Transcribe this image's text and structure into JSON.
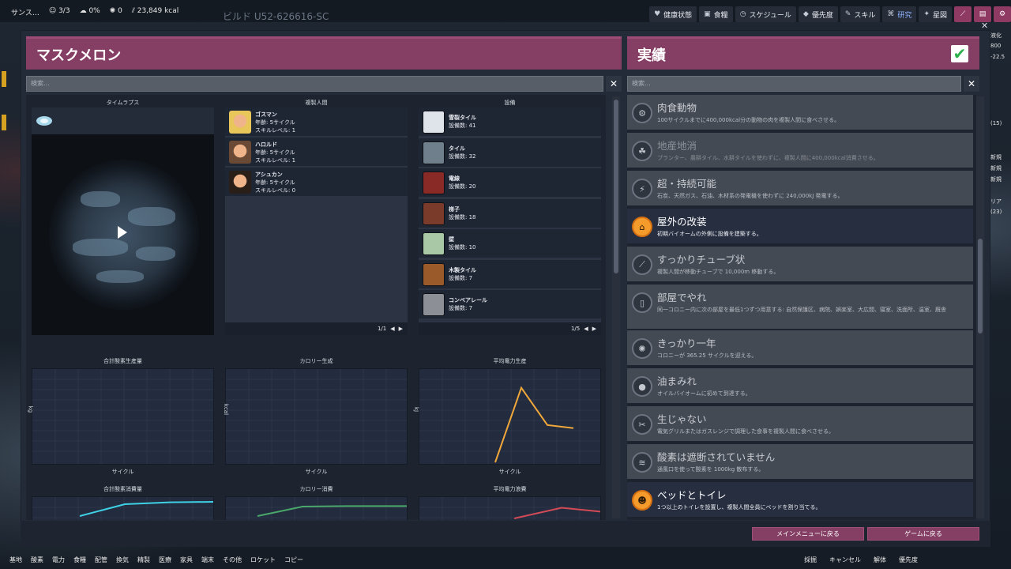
{
  "hud": {
    "colony_label": "サンス…",
    "dupes": "3/3",
    "stress": "0%",
    "germs": "0",
    "calories": "23,849 kcal",
    "build_title": "ビルド U52-626616-SC"
  },
  "topnav": [
    {
      "icon": "heart-icon",
      "glyph": "♥",
      "label": "健康状態"
    },
    {
      "icon": "food-icon",
      "glyph": "▣",
      "label": "食糧"
    },
    {
      "icon": "schedule-icon",
      "glyph": "◷",
      "label": "スケジュール"
    },
    {
      "icon": "priority-icon",
      "glyph": "◆",
      "label": "優先度"
    },
    {
      "icon": "skills-icon",
      "glyph": "✎",
      "label": "スキル"
    },
    {
      "icon": "research-icon",
      "glyph": "⌘",
      "label": "研究"
    },
    {
      "icon": "starmap-icon",
      "glyph": "✦",
      "label": "星図"
    }
  ],
  "left_panel": {
    "title": "マスクメロン",
    "search_placeholder": "検索...",
    "timelapse_label": "タイムラプス",
    "dupes_label": "複製人間",
    "buildings_label": "設備",
    "duplicants": [
      {
        "name": "ゴスマン",
        "age": "年齢: 5サイクル",
        "skill": "スキルレベル: 1",
        "color": "#e8c65a"
      },
      {
        "name": "ハロルド",
        "age": "年齢: 5サイクル",
        "skill": "スキルレベル: 1",
        "color": "#6a4a34"
      },
      {
        "name": "アシュカン",
        "age": "年齢: 5サイクル",
        "skill": "スキルレベル: 0",
        "color": "#2a1e18"
      }
    ],
    "dupes_pager": "1/1",
    "buildings": [
      {
        "name": "雪裂タイル",
        "count": "設備数: 41",
        "color": "#dfe4ea"
      },
      {
        "name": "タイル",
        "count": "設備数: 32",
        "color": "#6f7f8c"
      },
      {
        "name": "電線",
        "count": "設備数: 20",
        "color": "#8a2a26"
      },
      {
        "name": "梯子",
        "count": "設備数: 18",
        "color": "#7a3b2a"
      },
      {
        "name": "壁",
        "count": "設備数: 10",
        "color": "#a9c8a6"
      },
      {
        "name": "木製タイル",
        "count": "設備数: 7",
        "color": "#9a5a2a"
      },
      {
        "name": "コンベアレール",
        "count": "設備数: 7",
        "color": "#8c9096"
      }
    ],
    "buildings_pager": "1/5",
    "charts": [
      {
        "title": "合計酸素生産量",
        "ylabel": "kg",
        "xlabel": "サイクル"
      },
      {
        "title": "カロリー生成",
        "ylabel": "kcal",
        "xlabel": "サイクル"
      },
      {
        "title": "平均電力生産",
        "ylabel": "kJ",
        "xlabel": "サイクル"
      },
      {
        "title": "合計酸素消費量",
        "ylabel": "",
        "xlabel": ""
      },
      {
        "title": "カロリー消費",
        "ylabel": "",
        "xlabel": ""
      },
      {
        "title": "平均電力浪費",
        "ylabel": "",
        "xlabel": ""
      }
    ]
  },
  "chart_data": [
    {
      "type": "line",
      "title": "合計酸素生産量",
      "ylabel": "kg",
      "xlabel": "サイクル",
      "series": []
    },
    {
      "type": "line",
      "title": "カロリー生成",
      "ylabel": "kcal",
      "xlabel": "サイクル",
      "series": []
    },
    {
      "type": "line",
      "title": "平均電力生産",
      "ylabel": "kJ",
      "xlabel": "サイクル",
      "x": [
        2,
        3,
        4,
        5
      ],
      "series": [
        {
          "values": [
            0,
            24,
            12,
            11
          ],
          "color": "#f2a73a"
        }
      ]
    },
    {
      "type": "line",
      "title": "合計酸素消費量",
      "series": [
        {
          "values": [
            0.2,
            0.7,
            0.78,
            0.8,
            0.74
          ],
          "color": "#3fd0e6"
        }
      ]
    },
    {
      "type": "line",
      "title": "カロリー消費",
      "series": [
        {
          "values": [
            0.2,
            0.6,
            0.62,
            0.62,
            0.62
          ],
          "color": "#49a86a"
        }
      ]
    },
    {
      "type": "line",
      "title": "平均電力浪費",
      "series": [
        {
          "values": [
            0.1,
            0.55,
            0.35
          ],
          "color": "#d24a56"
        }
      ]
    }
  ],
  "right_panel": {
    "title": "実績",
    "search_placeholder": "検索...",
    "achievements": [
      {
        "title": "肉食動物",
        "desc": "100サイクルまでに400,000kcal分の動物の肉を複製人間に食べさせる。",
        "state": "locked",
        "icon": "meat-icon",
        "glyph": "⚙"
      },
      {
        "title": "地産地消",
        "desc": "プランター、農耕タイル、水耕タイルを使わずに、複製人間に400,000kcal消費させる。",
        "state": "dim",
        "icon": "locavore-icon",
        "glyph": "☘"
      },
      {
        "title": "超・持続可能",
        "desc": "石炭、天然ガス、石油、木材系の発電機を使わずに 240,000kJ 発電する。",
        "state": "locked",
        "icon": "power-icon",
        "glyph": "⚡"
      },
      {
        "title": "屋外の改装",
        "desc": "初期バイオームの外側に設備を建築する。",
        "state": "done",
        "icon": "exterior-icon",
        "glyph": "⌂"
      },
      {
        "title": "すっかりチューブ状",
        "desc": "複製人間が移動チューブで 10,000m 移動する。",
        "state": "locked",
        "icon": "tube-icon",
        "glyph": "⟋"
      },
      {
        "title": "部屋でやれ",
        "desc": "同一コロニー内に次の部屋を最低1つずつ用意する: 自然保護区、病院、娯楽室、大広間、寝室、洗面所、温室、厩舎",
        "state": "locked",
        "icon": "room-icon",
        "glyph": "▯"
      },
      {
        "title": "きっかり一年",
        "desc": "コロニーが 365.25 サイクルを迎える。",
        "state": "locked",
        "icon": "year-icon",
        "glyph": "✺"
      },
      {
        "title": "油まみれ",
        "desc": "オイルバイオームに初めて到達する。",
        "state": "locked",
        "icon": "oil-icon",
        "glyph": "●"
      },
      {
        "title": "生じゃない",
        "desc": "電気グリルまたはガスレンジで調理した食事を複製人間に食べさせる。",
        "state": "locked",
        "icon": "cook-icon",
        "glyph": "✂"
      },
      {
        "title": "酸素は遮断されていません",
        "desc": "通風口を使って酸素を 1000kg 散布する。",
        "state": "locked",
        "icon": "oxygen-icon",
        "glyph": "≋"
      },
      {
        "title": "ベッドとトイレ",
        "desc": "1つ以上のトイレを設置し、複製人間全員にベッドを割り当てる。",
        "state": "done",
        "icon": "bed-icon",
        "glyph": "☻"
      }
    ]
  },
  "buttons": {
    "main_menu": "メインメニューに戻る",
    "return_game": "ゲームに戻る"
  },
  "tools_left": [
    "基地",
    "酸素",
    "電力",
    "食糧",
    "配管",
    "換気",
    "精製",
    "医療",
    "家具",
    "端末",
    "その他",
    "ロケット",
    "コピー"
  ],
  "tools_right": [
    "採掘",
    "キャンセル",
    "解体",
    "優先度"
  ],
  "side_right": [
    "液化",
    "800",
    "-22.5",
    "",
    "",
    "",
    "",
    "",
    "(15)",
    "",
    "",
    "新規",
    "新規",
    "新規",
    "",
    "リア",
    "(23)"
  ]
}
